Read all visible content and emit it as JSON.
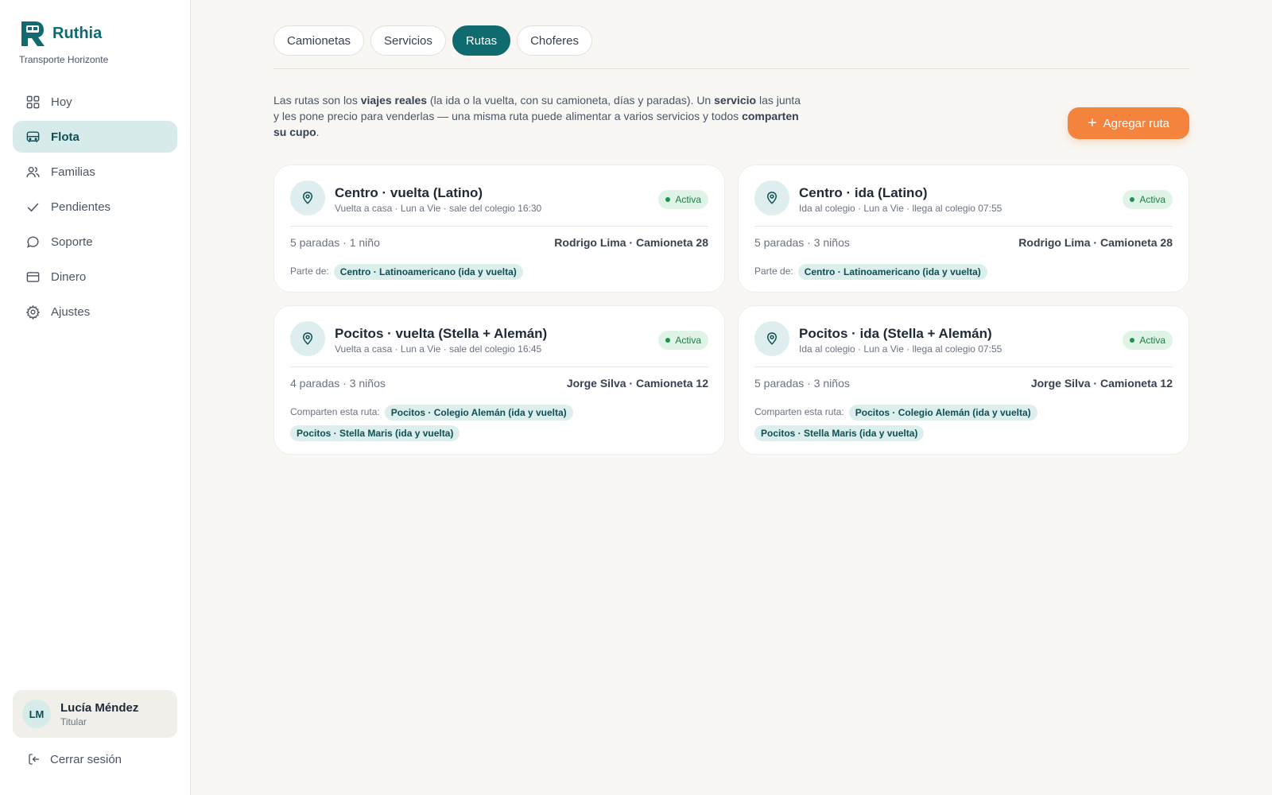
{
  "brand": {
    "name": "Ruthia",
    "subtitle": "Transporte Horizonte"
  },
  "nav": [
    {
      "label": "Hoy",
      "icon": "grid-icon"
    },
    {
      "label": "Flota",
      "icon": "bus-icon",
      "active": true
    },
    {
      "label": "Familias",
      "icon": "users-icon"
    },
    {
      "label": "Pendientes",
      "icon": "check-icon"
    },
    {
      "label": "Soporte",
      "icon": "chat-icon"
    },
    {
      "label": "Dinero",
      "icon": "card-icon"
    },
    {
      "label": "Ajustes",
      "icon": "gear-icon"
    }
  ],
  "user": {
    "initials": "LM",
    "name": "Lucía Méndez",
    "role": "Titular"
  },
  "logout_label": "Cerrar sesión",
  "tabs": [
    "Camionetas",
    "Servicios",
    "Rutas",
    "Choferes"
  ],
  "active_tab": "Rutas",
  "intro": {
    "p1": "Las rutas son los ",
    "b1": "viajes reales",
    "p2": " (la ida o la vuelta, con su camioneta, días y paradas). Un ",
    "b2": "servicio",
    "p3": " las junta y les pone precio para venderlas — una misma ruta puede alimentar a varios servicios y todos ",
    "b3": "comparten su cupo",
    "p4": "."
  },
  "add_button": "Agregar ruta",
  "routes": [
    {
      "title": "Centro · vuelta (Latino)",
      "subtitle": "Vuelta a casa · Lun a Vie · sale del colegio 16:30",
      "status": "Activa",
      "stats": "5 paradas · 1 niño",
      "driver": "Rodrigo Lima · Camioneta 28",
      "shared_label": "Parte de:",
      "services": [
        "Centro · Latinoamericano (ida y vuelta)"
      ]
    },
    {
      "title": "Centro · ida (Latino)",
      "subtitle": "Ida al colegio · Lun a Vie · llega al colegio 07:55",
      "status": "Activa",
      "stats": "5 paradas · 3 niños",
      "driver": "Rodrigo Lima · Camioneta 28",
      "shared_label": "Parte de:",
      "services": [
        "Centro · Latinoamericano (ida y vuelta)"
      ]
    },
    {
      "title": "Pocitos · vuelta (Stella + Alemán)",
      "subtitle": "Vuelta a casa · Lun a Vie · sale del colegio 16:45",
      "status": "Activa",
      "stats": "4 paradas · 3 niños",
      "driver": "Jorge Silva · Camioneta 12",
      "shared_label": "Comparten esta ruta:",
      "services": [
        "Pocitos · Colegio Alemán (ida y vuelta)",
        "Pocitos · Stella Maris (ida y vuelta)"
      ]
    },
    {
      "title": "Pocitos · ida (Stella + Alemán)",
      "subtitle": "Ida al colegio · Lun a Vie · llega al colegio 07:55",
      "status": "Activa",
      "stats": "5 paradas · 3 niños",
      "driver": "Jorge Silva · Camioneta 12",
      "shared_label": "Comparten esta ruta:",
      "services": [
        "Pocitos · Colegio Alemán (ida y vuelta)",
        "Pocitos · Stella Maris (ida y vuelta)"
      ]
    }
  ],
  "colors": {
    "brand": "#0f6b6e",
    "accent": "#f4843d",
    "active_badge": "#1f7a48"
  }
}
